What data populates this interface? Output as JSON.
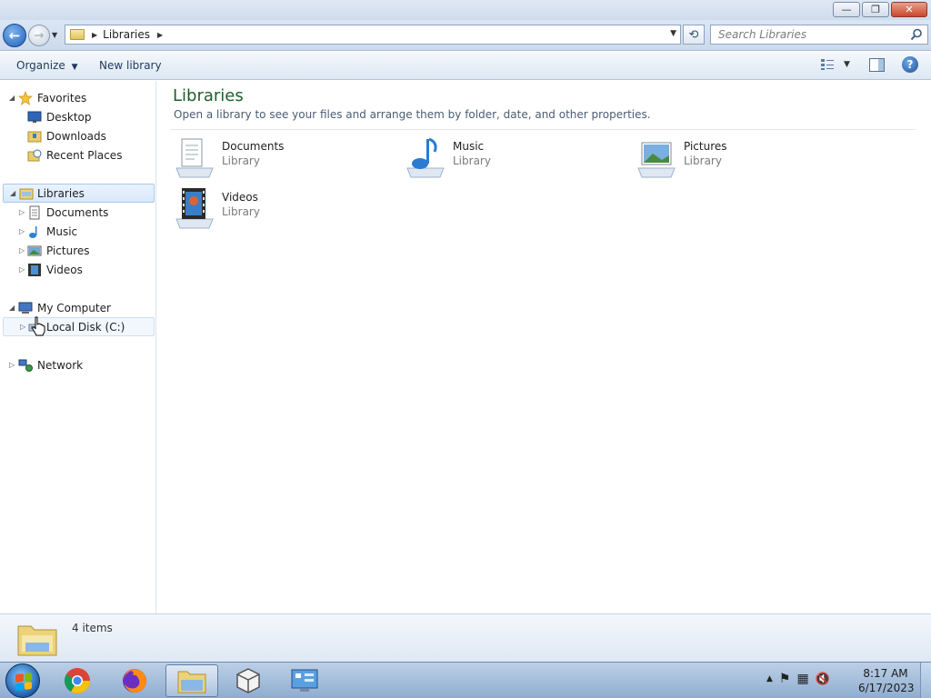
{
  "window": {
    "controls": {
      "minimize": "—",
      "maximize": "❐",
      "close": "✕"
    }
  },
  "address_bar": {
    "path": "Libraries",
    "search_placeholder": "Search Libraries",
    "back_glyph": "←",
    "refresh_glyph": "⟲"
  },
  "toolbar": {
    "organize_label": "Organize",
    "new_library_label": "New library"
  },
  "nav_pane": {
    "favorites": {
      "label": "Favorites",
      "items": [
        {
          "label": "Desktop",
          "icon": "desktop-icon"
        },
        {
          "label": "Downloads",
          "icon": "downloads-folder-icon"
        },
        {
          "label": "Recent Places",
          "icon": "recent-places-icon"
        }
      ]
    },
    "libraries": {
      "label": "Libraries",
      "items": [
        {
          "label": "Documents",
          "icon": "documents-icon"
        },
        {
          "label": "Music",
          "icon": "music-icon"
        },
        {
          "label": "Pictures",
          "icon": "pictures-icon"
        },
        {
          "label": "Videos",
          "icon": "videos-icon"
        }
      ]
    },
    "computer": {
      "label": "My Computer",
      "items": [
        {
          "label": "Local Disk (C:)",
          "icon": "local-disk-icon"
        }
      ]
    },
    "network": {
      "label": "Network"
    }
  },
  "content": {
    "title": "Libraries",
    "subtitle": "Open a library to see your files and arrange them by folder, date, and other properties.",
    "libraries": [
      {
        "name": "Documents",
        "type": "Library",
        "icon": "documents-library-icon"
      },
      {
        "name": "Music",
        "type": "Library",
        "icon": "music-library-icon"
      },
      {
        "name": "Pictures",
        "type": "Library",
        "icon": "pictures-library-icon"
      },
      {
        "name": "Videos",
        "type": "Library",
        "icon": "videos-library-icon"
      }
    ]
  },
  "details": {
    "item_count": "4 items"
  },
  "taskbar": {
    "apps": [
      {
        "name": "chrome",
        "icon": "chrome-icon"
      },
      {
        "name": "firefox",
        "icon": "firefox-icon"
      },
      {
        "name": "explorer",
        "icon": "file-explorer-icon",
        "active": true
      },
      {
        "name": "package",
        "icon": "package-box-icon"
      },
      {
        "name": "control-panel",
        "icon": "control-panel-icon"
      }
    ],
    "clock": {
      "time": "8:17 AM",
      "date": "6/17/2023"
    },
    "tray_glyphs": {
      "show_hidden": "▲",
      "flag": "⚑",
      "network": "▦",
      "volume": "🔇"
    }
  },
  "colors": {
    "title_green": "#1e5e2a",
    "command_text": "#1e395b",
    "selection": "#d9e9fb"
  }
}
